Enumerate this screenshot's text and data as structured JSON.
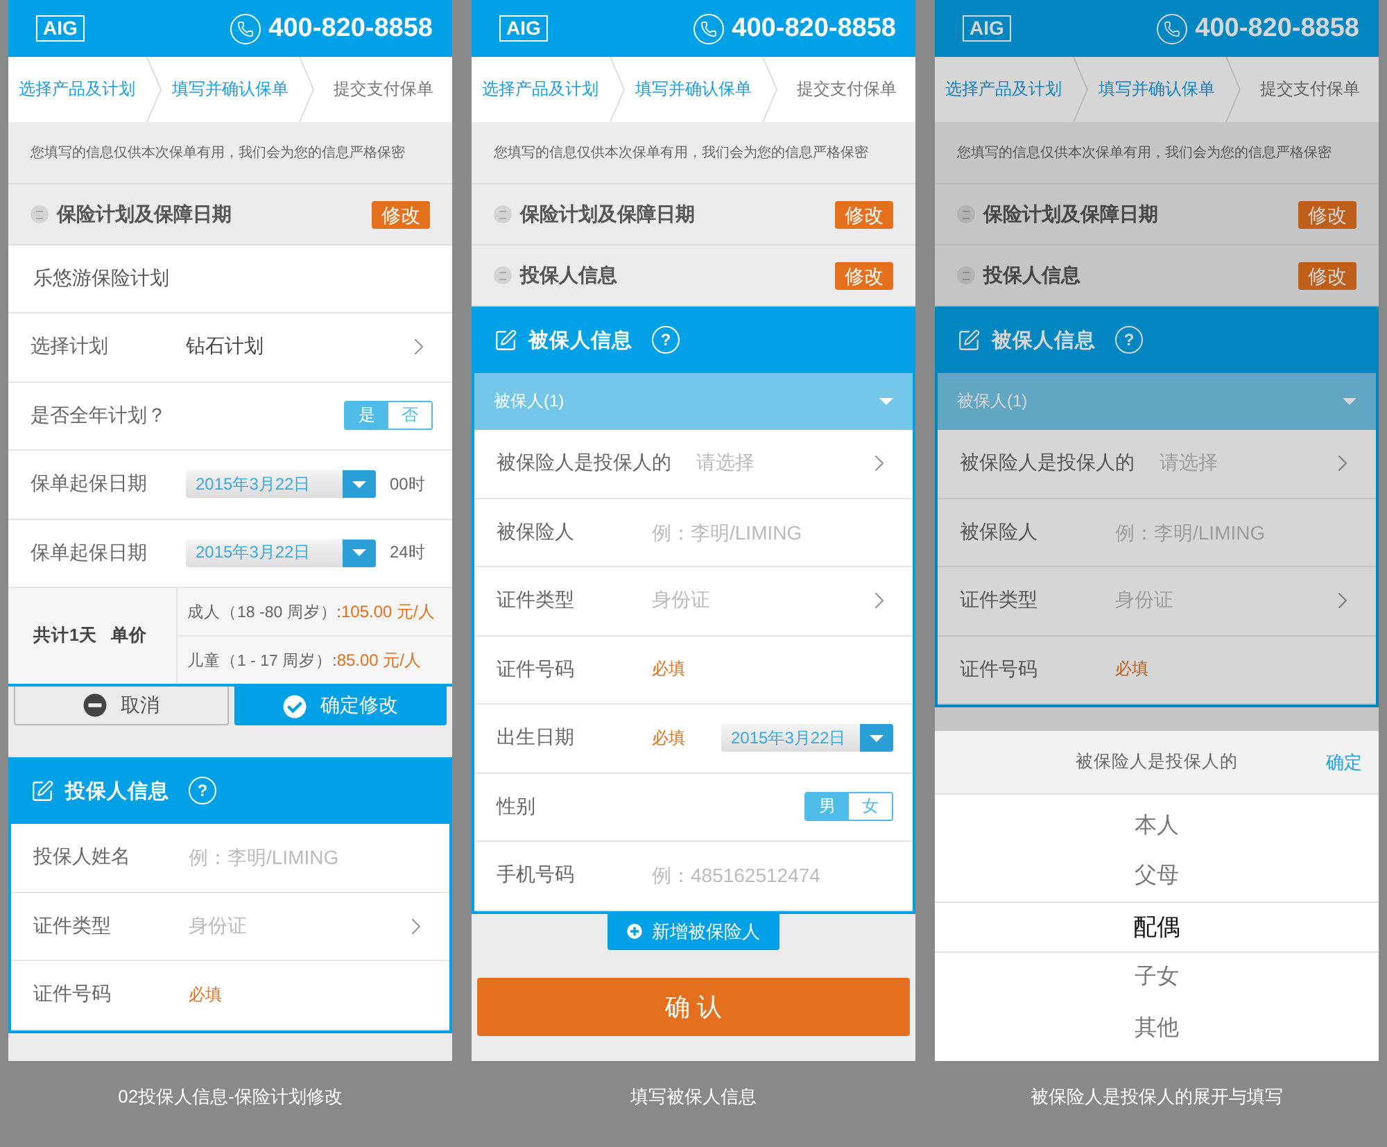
{
  "screens": [
    {
      "caption": "02投保人信息-保险计划修改",
      "header": {
        "brand": "AIG",
        "phone": "400-820-8858"
      },
      "steps": [
        {
          "label": "选择产品及计划",
          "active": true
        },
        {
          "label": "填写并确认保单",
          "active": true
        },
        {
          "label": "提交支付保单",
          "active": false
        }
      ],
      "notice": "您填写的信息仅供本次保单有用，我们会为您的信息严格保密",
      "blocks": [
        {
          "kind": "collapsed",
          "title": "保险计划及保障日期",
          "action": "修改"
        },
        {
          "kind": "plain",
          "text": "乐悠游保险计划"
        },
        {
          "kind": "field",
          "field": {
            "kind": "select",
            "label": "选择计划",
            "value": "钻石计划"
          }
        },
        {
          "kind": "field",
          "field": {
            "kind": "toggle",
            "label": "是否全年计划？",
            "options": [
              {
                "label": "是",
                "selected": true
              },
              {
                "label": "否",
                "selected": false
              }
            ]
          }
        },
        {
          "kind": "field",
          "field": {
            "kind": "date",
            "label": "保单起保日期",
            "date": "2015年3月22日",
            "suffix": "00时"
          }
        },
        {
          "kind": "field",
          "field": {
            "kind": "date",
            "label": "保单起保日期",
            "date": "2015年3月22日",
            "suffix": "24时"
          }
        },
        {
          "kind": "price",
          "labels": [
            "共计1天",
            "单价"
          ],
          "prices": [
            {
              "label": "成人（18 -80 周岁）:",
              "value": "105.00 元/人"
            },
            {
              "label": "儿童（1 - 17 周岁）:",
              "value": "85.00 元/人"
            }
          ]
        },
        {
          "kind": "actions",
          "buttons": [
            {
              "kind": "cancel",
              "label": "取消"
            },
            {
              "kind": "confirm",
              "label": "确定修改"
            }
          ]
        },
        {
          "kind": "form",
          "title": "投保人信息",
          "help": "?",
          "fields": [
            {
              "kind": "text",
              "label": "投保人姓名",
              "placeholder": "例：李明/LIMING"
            },
            {
              "kind": "select",
              "label": "证件类型",
              "placeholder": "身份证"
            },
            {
              "kind": "note",
              "label": "证件号码",
              "note": "必填"
            }
          ]
        }
      ]
    },
    {
      "caption": "填写被保人信息",
      "header": {
        "brand": "AIG",
        "phone": "400-820-8858"
      },
      "steps": [
        {
          "label": "选择产品及计划",
          "active": true
        },
        {
          "label": "填写并确认保单",
          "active": true
        },
        {
          "label": "提交支付保单",
          "active": false
        }
      ],
      "notice": "您填写的信息仅供本次保单有用，我们会为您的信息严格保密",
      "blocks": [
        {
          "kind": "collapsed",
          "title": "保险计划及保障日期",
          "action": "修改"
        },
        {
          "kind": "collapsed",
          "title": "投保人信息",
          "action": "修改"
        },
        {
          "kind": "form",
          "title": "被保人信息",
          "help": "?",
          "group": {
            "title": "被保人(1)",
            "expanded": true
          },
          "fields": [
            {
              "kind": "select",
              "label": "被保险人是投保人的",
              "placeholder": "请选择"
            },
            {
              "kind": "text",
              "label": "被保险人",
              "placeholder": "例：李明/LIMING"
            },
            {
              "kind": "select",
              "label": "证件类型",
              "placeholder": "身份证"
            },
            {
              "kind": "note",
              "label": "证件号码",
              "note": "必填"
            },
            {
              "kind": "date",
              "label": "出生日期",
              "note": "必填",
              "date": "2015年3月22日"
            },
            {
              "kind": "toggle",
              "label": "性别",
              "options": [
                {
                  "label": "男",
                  "selected": true
                },
                {
                  "label": "女",
                  "selected": false
                }
              ]
            },
            {
              "kind": "text",
              "label": "手机号码",
              "placeholder": "例：485162512474"
            }
          ]
        },
        {
          "kind": "add",
          "label": "新增被保险人"
        },
        {
          "kind": "primary",
          "label": "确 认"
        }
      ]
    },
    {
      "caption": "被保险人是投保人的展开与填写",
      "header": {
        "brand": "AIG",
        "phone": "400-820-8858"
      },
      "steps": [
        {
          "label": "选择产品及计划",
          "active": true
        },
        {
          "label": "填写并确认保单",
          "active": true
        },
        {
          "label": "提交支付保单",
          "active": false
        }
      ],
      "notice": "您填写的信息仅供本次保单有用，我们会为您的信息严格保密",
      "blocks": [
        {
          "kind": "collapsed",
          "title": "保险计划及保障日期",
          "action": "修改"
        },
        {
          "kind": "collapsed",
          "title": "投保人信息",
          "action": "修改"
        },
        {
          "kind": "form",
          "title": "被保人信息",
          "help": "?",
          "group": {
            "title": "被保人(1)",
            "expanded": true
          },
          "fields": [
            {
              "kind": "select",
              "label": "被保险人是投保人的",
              "placeholder": "请选择"
            },
            {
              "kind": "text",
              "label": "被保险人",
              "placeholder": "例：李明/LIMING"
            },
            {
              "kind": "select",
              "label": "证件类型",
              "placeholder": "身份证"
            },
            {
              "kind": "note",
              "label": "证件号码",
              "note": "必填"
            }
          ]
        }
      ],
      "picker": {
        "title": "被保险人是投保人的",
        "confirm": "确定",
        "options": [
          {
            "label": "本人",
            "selected": false
          },
          {
            "label": "父母",
            "selected": false
          },
          {
            "label": "配偶",
            "selected": true
          },
          {
            "label": "子女",
            "selected": false
          },
          {
            "label": "其他",
            "selected": false
          }
        ]
      }
    }
  ]
}
